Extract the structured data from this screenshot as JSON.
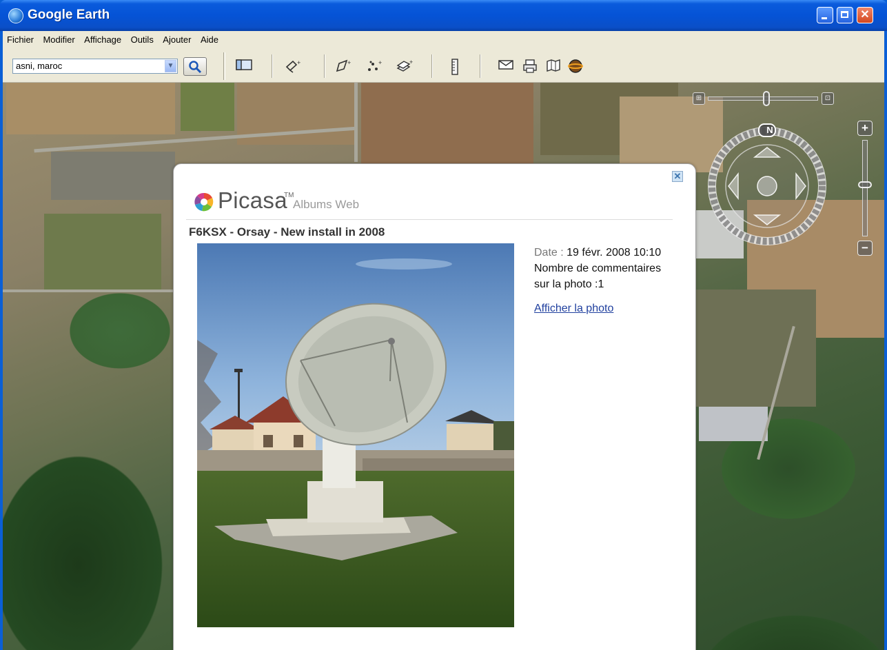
{
  "window": {
    "title": "Google Earth",
    "icon": "google-earth-icon"
  },
  "menu": {
    "items": [
      "Fichier",
      "Modifier",
      "Affichage",
      "Outils",
      "Ajouter",
      "Aide"
    ]
  },
  "toolbar": {
    "search_value": "asni, maroc",
    "buttons": [
      "search-icon",
      "sidebar-toggle-icon",
      "placemark-add-icon",
      "polygon-add-icon",
      "path-add-icon",
      "image-overlay-add-icon",
      "ruler-icon",
      "email-icon",
      "print-icon",
      "map-view-icon",
      "sky-icon"
    ]
  },
  "navigation": {
    "compass_north_label": "N"
  },
  "balloon": {
    "picasa_word": "Picasa",
    "picasa_tm": "TM",
    "picasa_sub": "Albums Web",
    "photo_title": "F6KSX - Orsay - New install in 2008",
    "date_label": "Date :",
    "date_value": "19 févr. 2008 10:10",
    "comments_text": "Nombre de commentaires sur la photo :1",
    "link_text": "Afficher la photo"
  },
  "colors": {
    "title_bar": "#0553d6",
    "menu_bg": "#ece9d8",
    "link": "#1f3f9e"
  }
}
